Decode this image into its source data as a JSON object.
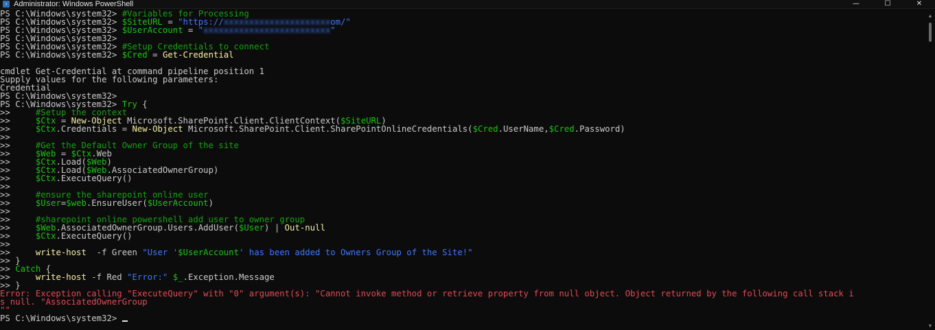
{
  "window": {
    "title": "Administrator: Windows PowerShell",
    "icon": "powershell-icon",
    "controls": {
      "minimize": "—",
      "maximize": "☐",
      "close": "✕"
    }
  },
  "colors": {
    "background": "#0c0c0c",
    "default_text": "#cccccc",
    "comment": "#13a10e",
    "variable": "#16c60c",
    "string": "#3b78ff",
    "command": "#f9f1a5",
    "error": "#e74856"
  },
  "console": {
    "lines": [
      [
        {
          "t": "PS C:\\Windows\\system32> ",
          "c": "prompt"
        },
        {
          "t": "#Variables for Processing",
          "c": "comment"
        }
      ],
      [
        {
          "t": "PS C:\\Windows\\system32> ",
          "c": "prompt"
        },
        {
          "t": "$SiteURL",
          "c": "var"
        },
        {
          "t": " = ",
          "c": "op"
        },
        {
          "t": "\"https://",
          "c": "string"
        },
        {
          "t": "xxxxxxxxxxxxxxxxxxxxx",
          "c": "redacted"
        },
        {
          "t": "om/\"",
          "c": "string"
        }
      ],
      [
        {
          "t": "PS C:\\Windows\\system32> ",
          "c": "prompt"
        },
        {
          "t": "$UserAccount",
          "c": "var"
        },
        {
          "t": " = ",
          "c": "op"
        },
        {
          "t": "\"",
          "c": "string"
        },
        {
          "t": "xxxxxxxxxxxxxxxxxxxxxxxxx",
          "c": "redacted"
        },
        {
          "t": "\"",
          "c": "string"
        }
      ],
      [
        {
          "t": "PS C:\\Windows\\system32>",
          "c": "prompt"
        }
      ],
      [
        {
          "t": "PS C:\\Windows\\system32> ",
          "c": "prompt"
        },
        {
          "t": "#Setup Credentials to connect",
          "c": "comment"
        }
      ],
      [
        {
          "t": "PS C:\\Windows\\system32> ",
          "c": "prompt"
        },
        {
          "t": "$Cred",
          "c": "var"
        },
        {
          "t": " = ",
          "c": "op"
        },
        {
          "t": "Get-Credential",
          "c": "cmd"
        }
      ],
      [
        {
          "t": "",
          "c": "prompt"
        }
      ],
      [
        {
          "t": "cmdlet Get-Credential at command pipeline position 1",
          "c": "prompt"
        }
      ],
      [
        {
          "t": "Supply values for the following parameters:",
          "c": "prompt"
        }
      ],
      [
        {
          "t": "Credential",
          "c": "prompt"
        }
      ],
      [
        {
          "t": "PS C:\\Windows\\system32>",
          "c": "prompt"
        }
      ],
      [
        {
          "t": "PS C:\\Windows\\system32> ",
          "c": "prompt"
        },
        {
          "t": "Try",
          "c": "var"
        },
        {
          "t": " {",
          "c": "op"
        }
      ],
      [
        {
          "t": ">>     ",
          "c": "prompt"
        },
        {
          "t": "#Setup the context",
          "c": "comment"
        }
      ],
      [
        {
          "t": ">>     ",
          "c": "prompt"
        },
        {
          "t": "$Ctx",
          "c": "var"
        },
        {
          "t": " = ",
          "c": "op"
        },
        {
          "t": "New-Object",
          "c": "cmd"
        },
        {
          "t": " Microsoft.SharePoint.Client.ClientContext(",
          "c": "op"
        },
        {
          "t": "$SiteURL",
          "c": "var"
        },
        {
          "t": ")",
          "c": "op"
        }
      ],
      [
        {
          "t": ">>     ",
          "c": "prompt"
        },
        {
          "t": "$Ctx",
          "c": "var"
        },
        {
          "t": ".Credentials = ",
          "c": "op"
        },
        {
          "t": "New-Object",
          "c": "cmd"
        },
        {
          "t": " Microsoft.SharePoint.Client.SharePointOnlineCredentials(",
          "c": "op"
        },
        {
          "t": "$Cred",
          "c": "var"
        },
        {
          "t": ".UserName,",
          "c": "op"
        },
        {
          "t": "$Cred",
          "c": "var"
        },
        {
          "t": ".Password)",
          "c": "op"
        }
      ],
      [
        {
          "t": ">>",
          "c": "prompt"
        }
      ],
      [
        {
          "t": ">>     ",
          "c": "prompt"
        },
        {
          "t": "#Get the Default Owner Group of the site",
          "c": "comment"
        }
      ],
      [
        {
          "t": ">>     ",
          "c": "prompt"
        },
        {
          "t": "$Web",
          "c": "var"
        },
        {
          "t": " = ",
          "c": "op"
        },
        {
          "t": "$Ctx",
          "c": "var"
        },
        {
          "t": ".Web",
          "c": "op"
        }
      ],
      [
        {
          "t": ">>     ",
          "c": "prompt"
        },
        {
          "t": "$Ctx",
          "c": "var"
        },
        {
          "t": ".Load(",
          "c": "op"
        },
        {
          "t": "$Web",
          "c": "var"
        },
        {
          "t": ")",
          "c": "op"
        }
      ],
      [
        {
          "t": ">>     ",
          "c": "prompt"
        },
        {
          "t": "$Ctx",
          "c": "var"
        },
        {
          "t": ".Load(",
          "c": "op"
        },
        {
          "t": "$Web",
          "c": "var"
        },
        {
          "t": ".AssociatedOwnerGroup)",
          "c": "op"
        }
      ],
      [
        {
          "t": ">>     ",
          "c": "prompt"
        },
        {
          "t": "$Ctx",
          "c": "var"
        },
        {
          "t": ".ExecuteQuery()",
          "c": "op"
        }
      ],
      [
        {
          "t": ">>",
          "c": "prompt"
        }
      ],
      [
        {
          "t": ">>     ",
          "c": "prompt"
        },
        {
          "t": "#ensure the sharepoint online user",
          "c": "comment"
        }
      ],
      [
        {
          "t": ">>     ",
          "c": "prompt"
        },
        {
          "t": "$User",
          "c": "var"
        },
        {
          "t": "=",
          "c": "op"
        },
        {
          "t": "$web",
          "c": "var"
        },
        {
          "t": ".EnsureUser(",
          "c": "op"
        },
        {
          "t": "$UserAccount",
          "c": "var"
        },
        {
          "t": ")",
          "c": "op"
        }
      ],
      [
        {
          "t": ">>",
          "c": "prompt"
        }
      ],
      [
        {
          "t": ">>     ",
          "c": "prompt"
        },
        {
          "t": "#sharepoint online powershell add user to owner group",
          "c": "comment"
        }
      ],
      [
        {
          "t": ">>     ",
          "c": "prompt"
        },
        {
          "t": "$Web",
          "c": "var"
        },
        {
          "t": ".AssociatedOwnerGroup.Users.AddUser(",
          "c": "op"
        },
        {
          "t": "$User",
          "c": "var"
        },
        {
          "t": ") | ",
          "c": "op"
        },
        {
          "t": "Out-null",
          "c": "cmd"
        }
      ],
      [
        {
          "t": ">>     ",
          "c": "prompt"
        },
        {
          "t": "$Ctx",
          "c": "var"
        },
        {
          "t": ".ExecuteQuery()",
          "c": "op"
        }
      ],
      [
        {
          "t": ">>",
          "c": "prompt"
        }
      ],
      [
        {
          "t": ">>     ",
          "c": "prompt"
        },
        {
          "t": "write-host",
          "c": "cmd"
        },
        {
          "t": "  -f Green ",
          "c": "op"
        },
        {
          "t": "\"User '",
          "c": "string"
        },
        {
          "t": "$UserAccount",
          "c": "var"
        },
        {
          "t": "' has been added to Owners Group of the Site!\"",
          "c": "string"
        }
      ],
      [
        {
          "t": ">> }",
          "c": "prompt"
        }
      ],
      [
        {
          "t": ">> ",
          "c": "prompt"
        },
        {
          "t": "Catch",
          "c": "var"
        },
        {
          "t": " {",
          "c": "op"
        }
      ],
      [
        {
          "t": ">>     ",
          "c": "prompt"
        },
        {
          "t": "write-host",
          "c": "cmd"
        },
        {
          "t": " -f Red ",
          "c": "op"
        },
        {
          "t": "\"Error:\"",
          "c": "string"
        },
        {
          "t": " ",
          "c": "op"
        },
        {
          "t": "$_",
          "c": "var"
        },
        {
          "t": ".Exception.Message",
          "c": "op"
        }
      ],
      [
        {
          "t": ">> }",
          "c": "prompt"
        }
      ],
      [
        {
          "t": "Error: Exception calling \"ExecuteQuery\" with \"0\" argument(s): \"Cannot invoke method or retrieve property from null object. Object returned by the following call stack i",
          "c": "error"
        }
      ],
      [
        {
          "t": "s null. \"AssociatedOwnerGroup",
          "c": "error"
        }
      ],
      [
        {
          "t": "\"\"",
          "c": "error"
        }
      ],
      [
        {
          "t": "PS C:\\Windows\\system32> ",
          "c": "prompt"
        },
        {
          "t": "",
          "c": "cursor"
        }
      ]
    ]
  }
}
